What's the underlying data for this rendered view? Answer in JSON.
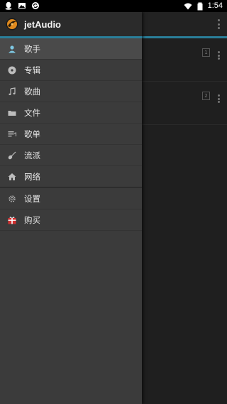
{
  "status_bar": {
    "time": "1:54",
    "left_icons": [
      "qq-icon",
      "gallery-icon",
      "sync-icon"
    ],
    "right_icons": [
      "wifi-icon",
      "battery-icon"
    ]
  },
  "drawer": {
    "app_title": "jetAudio",
    "logo_icon": "jetaudio-logo",
    "items": [
      {
        "label": "歌手",
        "icon": "artist-icon",
        "active": true
      },
      {
        "label": "专辑",
        "icon": "album-icon"
      },
      {
        "label": "歌曲",
        "icon": "music-note-icon"
      },
      {
        "label": "文件",
        "icon": "folder-icon"
      },
      {
        "label": "歌单",
        "icon": "playlist-icon"
      },
      {
        "label": "流派",
        "icon": "guitar-icon"
      },
      {
        "label": "网络",
        "icon": "network-icon"
      },
      {
        "label": "设置",
        "icon": "settings-icon"
      },
      {
        "label": "购买",
        "icon": "purchase-icon"
      }
    ]
  },
  "main": {
    "rows": [
      {
        "badge": "1"
      },
      {
        "badge": "2"
      }
    ]
  },
  "colors": {
    "accent": "#2a7f9a",
    "drawer_bg": "#3b3b3b",
    "active_item": "#4a4a4a"
  }
}
